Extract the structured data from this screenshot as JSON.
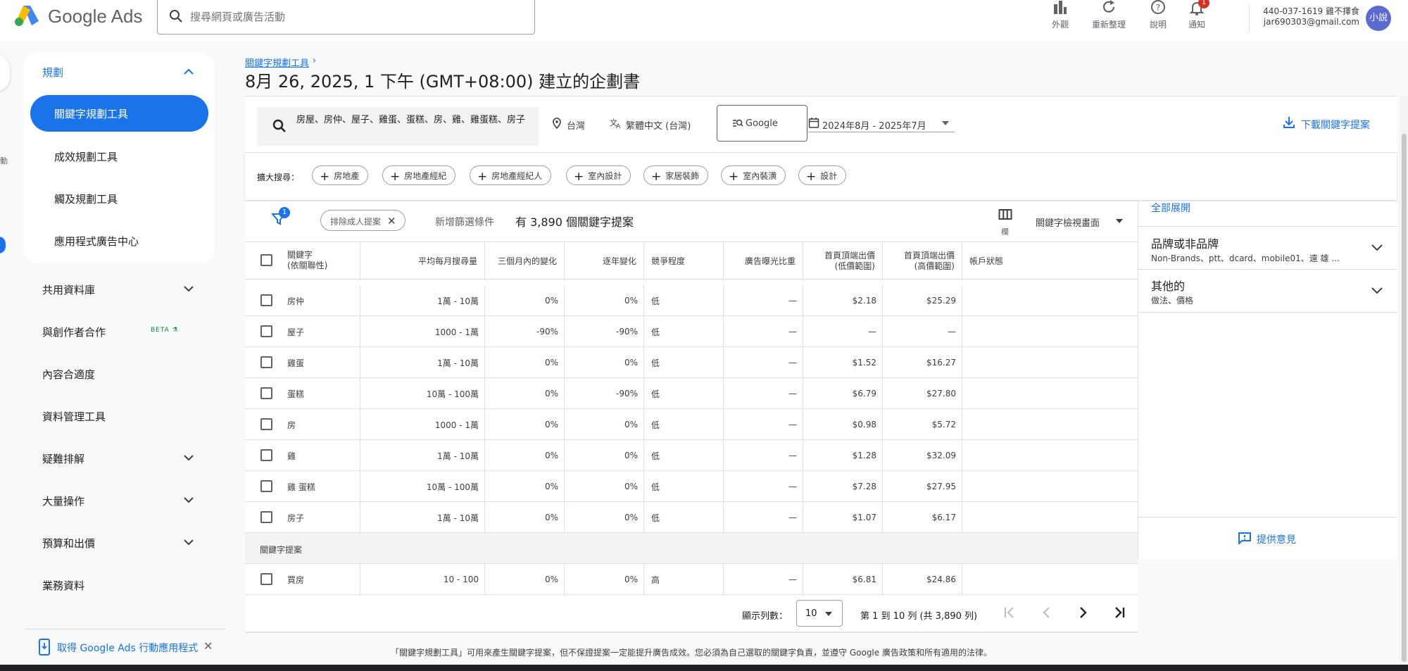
{
  "app": {
    "name": "Google Ads"
  },
  "search": {
    "placeholder": "搜尋網頁或廣告活動"
  },
  "toolbar": [
    {
      "label": "外觀",
      "icon": "appearance-icon"
    },
    {
      "label": "重新整理",
      "icon": "refresh-icon"
    },
    {
      "label": "說明",
      "icon": "help-icon"
    },
    {
      "label": "通知",
      "icon": "bell-icon",
      "badge": "1"
    }
  ],
  "account": {
    "id": "440-037-1619 雞不擇食",
    "email": "jar690303@gmail.com",
    "avatar": "小說"
  },
  "sidebar": {
    "planning": "規劃",
    "sub_items": [
      "關鍵字規劃工具",
      "成效規劃工具",
      "觸及規劃工具",
      "應用程式廣告中心"
    ],
    "sections": [
      "共用資料庫",
      "與創作者合作",
      "內容合適度",
      "資料管理工具",
      "疑難排解",
      "大量操作",
      "預算和出價",
      "業務資料"
    ],
    "beta": "BETA ⚗",
    "app_banner": "取得 Google Ads 行動應用程式"
  },
  "rail": {
    "text": "動"
  },
  "header": {
    "breadcrumb": "關鍵字規劃工具",
    "breadcrumb_sep": "›",
    "title": "8月 26, 2025, 1 下午 (GMT+08:00) 建立的企劃書"
  },
  "query": {
    "keywords": "房屋、房仲、屋子、雞蛋、蛋糕、房、雞、雞蛋糕、房子",
    "location": "台灣",
    "language": "繁體中文 (台灣)",
    "network": "Google",
    "date_range": "2024年8月 - 2025年7月",
    "download": "下載關鍵字提案"
  },
  "broaden": {
    "label": "擴大搜尋：",
    "chips": [
      "房地產",
      "房地產經紀",
      "房地產經紀人",
      "室內設計",
      "家居裝飾",
      "室內裝潢",
      "設計"
    ]
  },
  "filters": {
    "badge": "1",
    "exclude": "排除成人提案",
    "add_filter": "新增篩選條件",
    "result_count": "有 3,890 個關鍵字提案",
    "columns_label": "欄",
    "view_label": "關鍵字檢視畫面"
  },
  "table": {
    "headers": [
      "關鍵字\n(依關聯性)",
      "平均每月搜尋量",
      "三個月內的變化",
      "逐年變化",
      "競爭程度",
      "廣告曝光比重",
      "首頁頂端出價\n(低價範圍)",
      "首頁頂端出價\n(高價範圍)",
      "帳戶狀態"
    ],
    "rows": [
      [
        "房仲",
        "1萬 - 10萬",
        "0%",
        "0%",
        "低",
        "—",
        "$2.18",
        "$25.29"
      ],
      [
        "屋子",
        "1000 - 1萬",
        "-90%",
        "-90%",
        "低",
        "—",
        "—",
        "—"
      ],
      [
        "雞蛋",
        "1萬 - 10萬",
        "0%",
        "0%",
        "低",
        "—",
        "$1.52",
        "$16.27"
      ],
      [
        "蛋糕",
        "10萬 - 100萬",
        "0%",
        "-90%",
        "低",
        "—",
        "$6.79",
        "$27.80"
      ],
      [
        "房",
        "1000 - 1萬",
        "0%",
        "0%",
        "低",
        "—",
        "$0.98",
        "$5.72"
      ],
      [
        "雞",
        "1萬 - 10萬",
        "0%",
        "0%",
        "低",
        "—",
        "$1.28",
        "$32.09"
      ],
      [
        "雞 蛋糕",
        "10萬 - 100萬",
        "0%",
        "0%",
        "低",
        "—",
        "$7.28",
        "$27.95"
      ],
      [
        "房子",
        "1萬 - 10萬",
        "0%",
        "0%",
        "低",
        "—",
        "$1.07",
        "$6.17"
      ]
    ],
    "section_label": "關鍵字提案",
    "suggest_rows": [
      [
        "買房",
        "10 - 100",
        "0%",
        "0%",
        "高",
        "—",
        "$6.81",
        "$24.86"
      ]
    ]
  },
  "pagination": {
    "rows_label": "顯示列數：",
    "rows_value": "10",
    "range": "第 1 到 10 列 (共 3,890 列)"
  },
  "right_panel": {
    "expand_all": "全部展開",
    "groups": [
      {
        "title": "品牌或非品牌",
        "sub": "Non-Brands、ptt、dcard、mobile01、遠 雄 ..."
      },
      {
        "title": "其他的",
        "sub": "做法、價格"
      }
    ],
    "feedback": "提供意見"
  },
  "disclaimer": "「關鍵字規劃工具」可用來產生關鍵字提案，但不保證提案一定能提升廣告成效。您必須為自己選取的關鍵字負責，並遵守 Google 廣告政策和所有適用的法律。",
  "colors": {
    "accent": "#1a73e8",
    "badge_red": "#d93025",
    "avatar": "#5b6ad0"
  }
}
